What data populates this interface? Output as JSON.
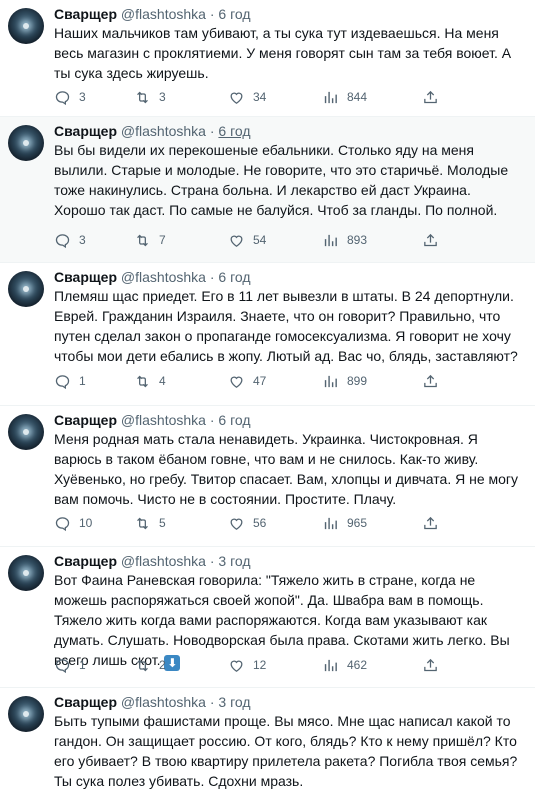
{
  "tweets": [
    {
      "name": "Сварщер",
      "handle": "@flashtoshka",
      "dot": "·",
      "time": "6 год",
      "text": "Наших мальчиков там убивают, а ты сука тут издеваешься. На меня весь магазин с проклятиеми. У меня говорят сын там за тебя воюет. А ты сука здесь жируешь.",
      "replies": "3",
      "retweets": "3",
      "likes": "34",
      "views": "844"
    },
    {
      "name": "Сварщер",
      "handle": "@flashtoshka",
      "dot": "·",
      "time": "6 год",
      "text": "Вы бы видели их перекошеные ебальники. Столько яду на меня вылили. Старые и молодые. Не говорите, что это старичьё. Молодые тоже накинулись. Страна больна. И лекарство ей даст Украина. Хорошо так даст. По самые не балуйся. Чтоб за гланды. По полной.",
      "replies": "3",
      "retweets": "7",
      "likes": "54",
      "views": "893"
    },
    {
      "name": "Сварщер",
      "handle": "@flashtoshka",
      "dot": "·",
      "time": "6 год",
      "text": "Племяш щас приедет. Его в 11 лет вывезли в штаты. В 24 депортнули. Еврей. Гражданин Израиля. Знаете, что он говорит? Правильно, что путен сделал закон о пропаганде гомосексуализма. Я говорит не хочу чтобы мои дети ебались в жопу. Лютый ад. Вас чо, блядь, заставляют?",
      "replies": "1",
      "retweets": "4",
      "likes": "47",
      "views": "899"
    },
    {
      "name": "Сварщер",
      "handle": "@flashtoshka",
      "dot": "·",
      "time": "6 год",
      "text": "Меня родная мать стала ненавидеть. Украинка. Чистокровная. Я варюсь в таком ёбаном говне, что вам и не снилось. Как-то живу. Хуёвенько, но гребу. Твитор спасает. Вам, хлопцы и дивчата. Я не могу вам помочь. Чисто не в состоянии. Простите. Плачу.",
      "replies": "10",
      "retweets": "5",
      "likes": "56",
      "views": "965"
    },
    {
      "name": "Сварщер",
      "handle": "@flashtoshka",
      "dot": "·",
      "time": "3 год",
      "text": "Вот Фаина Раневская говорила: \"Тяжело жить в стране, когда не можешь распоряжаться своей жопой\". Да. Швабра вам в помощь. Тяжело жить когда вами распоряжаются. Когда вам указывают как думать. Слушать. Новодворская была права. Скотами жить легко. Вы всего лишь скот.",
      "emoji": "⬇",
      "replies": "1",
      "retweets": "2",
      "likes": "12",
      "views": "462"
    },
    {
      "name": "Сварщер",
      "handle": "@flashtoshka",
      "dot": "·",
      "time": "3 год",
      "text": "Быть тупыми фашистами проще. Вы мясо. Мне щас написал какой то гандон. Он защищает россию. От кого, блядь? Кто к нему пришёл? Кто его убивает? В твою квартиру прилетела ракета? Погибла твоя семья?Ты сука полез убивать. Сдохни мразь."
    }
  ],
  "icons": {
    "reply": "reply-icon",
    "retweet": "retweet-icon",
    "like": "like-icon",
    "views": "views-icon",
    "share": "share-icon"
  }
}
